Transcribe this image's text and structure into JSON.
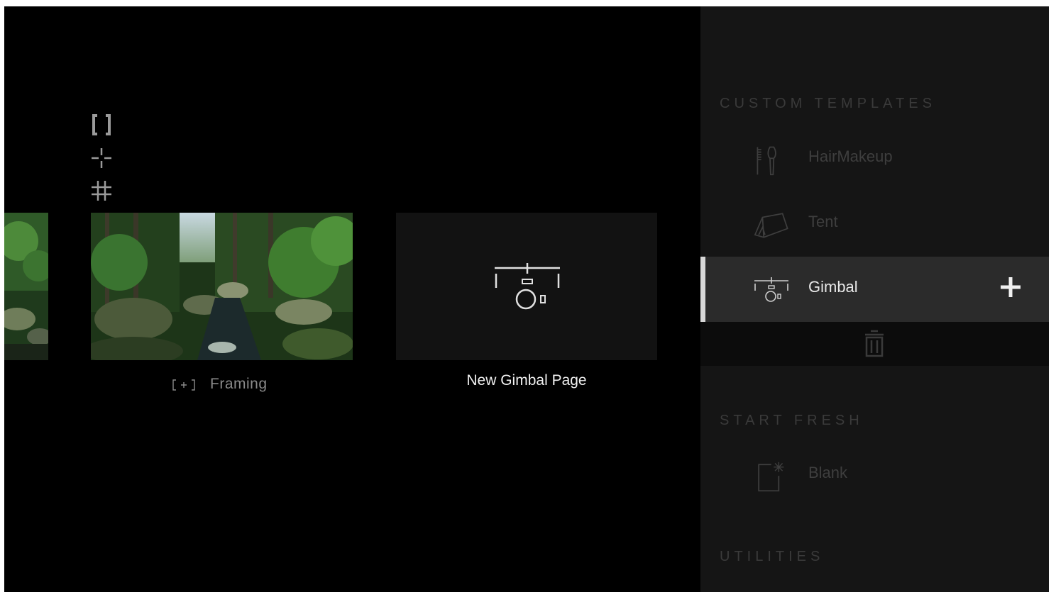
{
  "tools": [
    {
      "name": "bracket-frame-icon"
    },
    {
      "name": "crosshair-icon"
    },
    {
      "name": "grid-icon"
    }
  ],
  "thumbnails": {
    "framing": {
      "label": "Framing",
      "icon": "framing-icon"
    },
    "new_gimbal": {
      "label": "New Gimbal Page",
      "icon": "gimbal-icon"
    }
  },
  "panel": {
    "custom_templates": {
      "heading": "CUSTOM TEMPLATES",
      "items": [
        {
          "label": "HairMakeup",
          "icon": "hair-makeup-icon"
        },
        {
          "label": "Tent",
          "icon": "tent-icon"
        },
        {
          "label": "Gimbal",
          "icon": "gimbal-icon",
          "selected": true
        }
      ]
    },
    "start_fresh": {
      "heading": "START FRESH",
      "items": [
        {
          "label": "Blank",
          "icon": "blank-page-icon"
        }
      ]
    },
    "utilities": {
      "heading": "UTILITIES"
    }
  },
  "colors": {
    "screen_bg": "#000000",
    "panel_bg": "#151515",
    "selected_row": "#2b2b2b",
    "selected_text": "#e8e8e8",
    "dim_text": "#3e3e3e"
  }
}
